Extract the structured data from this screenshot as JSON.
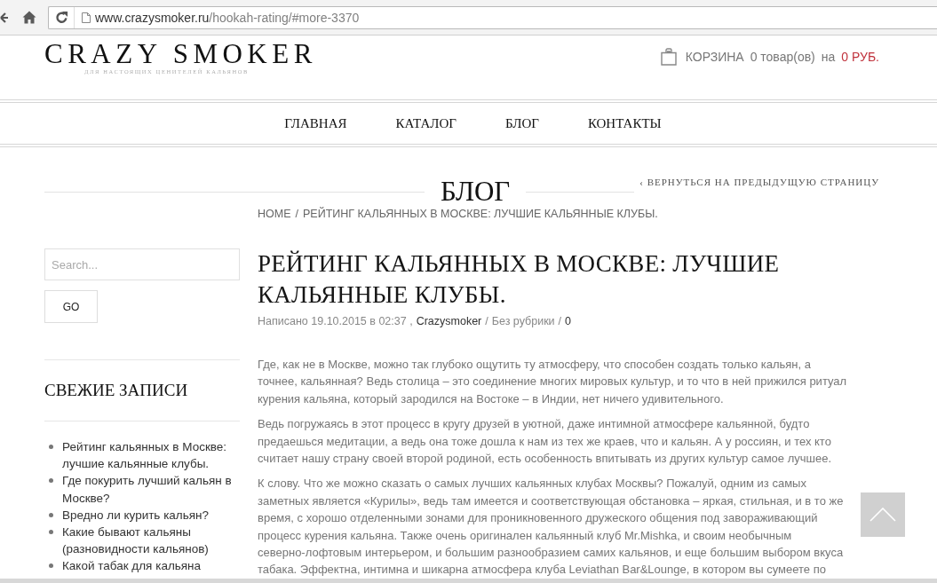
{
  "browser": {
    "url_host": "www.crazysmoker.ru",
    "url_path": "/hookah-rating/#more-3370"
  },
  "header": {
    "logo": "CRAZY SMOKER",
    "tagline": "ДЛЯ НАСТОЯЩИХ ЦЕНИТЕЛЕЙ КАЛЬЯНОВ",
    "cart": {
      "label": "КОРЗИНА",
      "count": "0 товар(ов)",
      "connector": "на",
      "total": "0 РУБ."
    }
  },
  "nav": [
    "ГЛАВНАЯ",
    "КАТАЛОГ",
    "БЛОГ",
    "КОНТАКТЫ"
  ],
  "page_heading": {
    "title": "БЛОГ",
    "back_link": "‹ ВЕРНУТЬСЯ НА ПРЕДЫДУЩУЮ СТРАНИЦУ"
  },
  "breadcrumb": {
    "items": [
      "HOME",
      "РЕЙТИНГ КАЛЬЯННЫХ В МОСКВЕ: ЛУЧШИЕ КАЛЬЯННЫЕ КЛУБЫ."
    ],
    "separator": "/"
  },
  "sidebar": {
    "search": {
      "placeholder": "Search...",
      "button": "GO"
    },
    "recent_posts": {
      "title": "СВЕЖИЕ ЗАПИСИ",
      "items": [
        "Рейтинг кальянных в Москве: лучшие кальянные клубы.",
        "Где покурить лучший кальян в Москве?",
        "Вредно ли курить кальян?",
        "Какие бывают кальяны (разновидности кальянов)",
        "Какой табак для кальяна"
      ]
    }
  },
  "article": {
    "title": "РЕЙТИНГ КАЛЬЯННЫХ В МОСКВЕ: ЛУЧШИЕ КАЛЬЯННЫЕ КЛУБЫ.",
    "meta": [
      {
        "kind": "text",
        "text": "Написано 19.10.2015 в 02:37 ,"
      },
      {
        "kind": "link",
        "text": "Crazysmoker"
      },
      {
        "kind": "text",
        "text": "/"
      },
      {
        "kind": "text",
        "text": "Без рубрики"
      },
      {
        "kind": "text",
        "text": "/"
      },
      {
        "kind": "link",
        "text": "0"
      }
    ],
    "paragraphs": [
      "Где, как не в Москве, можно так глубоко ощутить ту атмосферу, что способен создать только кальян, а\nточнее, кальянная? Ведь столица – это соединение многих мировых культур, и то что в ней прижился ритуал\nкурения кальяна, который зародился на Востоке – в Индии, нет ничего удивительного.",
      "Ведь погружаясь в этот процесс в кругу друзей в уютной, даже интимной атмосфере кальянной, будто\nпредаешься медитации, а ведь она тоже дошла к нам из тех же краев, что и кальян. А у россиян, и тех кто\nсчитает нашу страну своей второй родиной, есть особенность впитывать из других культур самое лучшее.",
      "К слову. Что же можно сказать о самых лучших кальянных клубах Москвы? Пожалуй, одним из самых\nзаметных является «Курилы», ведь там имеется и соответствующая обстановка – яркая, стильная, и в то же\nвремя, с хорошо отделенными зонами для проникновенного дружеского общения под завораживающий\nпроцесс курения кальяна. Также очень оригинален кальянный клуб Mr.Mishka, и своим необычным\nсеверно-лофтовым интерьером, и большим разнообразием самих кальянов, и еще большим выбором вкуса\nтабака. Эффектна, интимна и шикарна атмосфера клуба Leviathan Bar&Lounge, в котором вы сумеете по"
    ]
  }
}
